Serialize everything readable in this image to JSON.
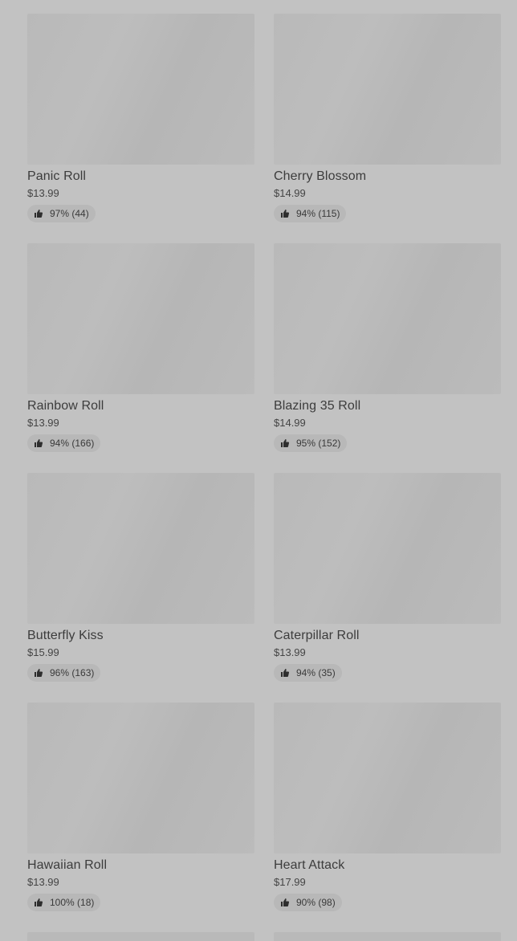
{
  "menu": {
    "items": [
      {
        "name": "Panic Roll",
        "price": "$13.99",
        "rating": "97% (44)"
      },
      {
        "name": "Cherry Blossom",
        "price": "$14.99",
        "rating": "94% (115)"
      },
      {
        "name": "Rainbow Roll",
        "price": "$13.99",
        "rating": "94% (166)"
      },
      {
        "name": "Blazing 35 Roll",
        "price": "$14.99",
        "rating": "95% (152)"
      },
      {
        "name": "Butterfly Kiss",
        "price": "$15.99",
        "rating": "96% (163)"
      },
      {
        "name": "Caterpillar Roll",
        "price": "$13.99",
        "rating": "94% (35)"
      },
      {
        "name": "Hawaiian Roll",
        "price": "$13.99",
        "rating": "100% (18)"
      },
      {
        "name": "Heart Attack",
        "price": "$17.99",
        "rating": "90% (98)"
      }
    ]
  },
  "icons": {
    "rating": "thumbs-up-icon"
  },
  "colors": {
    "background": "#c2c2c2",
    "placeholder": "#b9b9b9",
    "badge": "#b8b8b8",
    "text": "#3c3c3c"
  }
}
